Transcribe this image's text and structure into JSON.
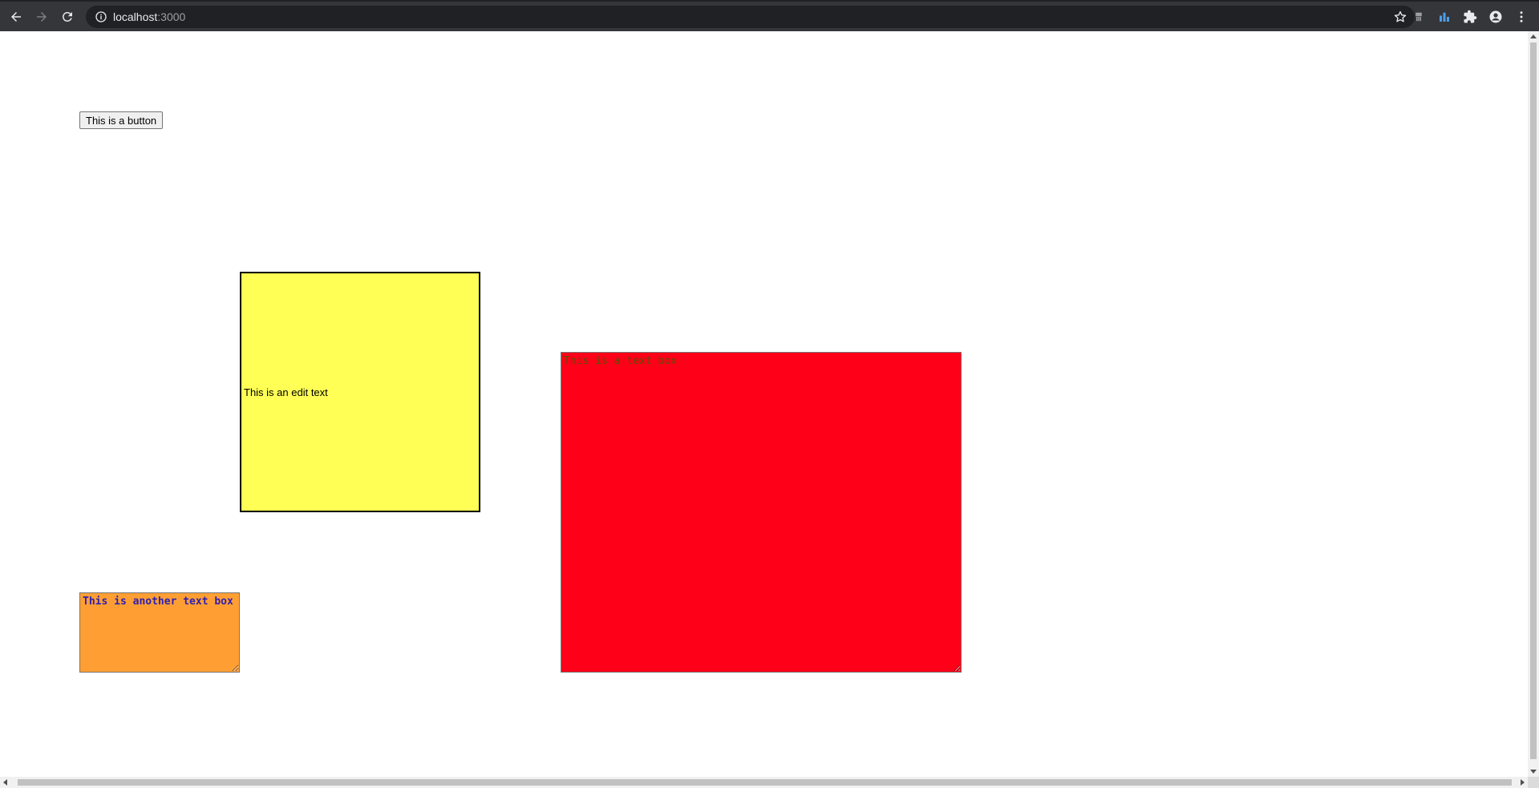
{
  "browser": {
    "url_host": "localhost",
    "url_port": ":3000",
    "icons": {
      "back": "arrow-left-icon",
      "forward": "arrow-right-icon",
      "reload": "reload-icon",
      "info": "info-icon",
      "bookmark": "star-icon",
      "extension_1": "extension-icon",
      "extension_2": "bar-chart-icon",
      "extensions_menu": "puzzle-icon",
      "profile": "profile-icon",
      "menu": "more-vertical-icon"
    }
  },
  "page": {
    "button_label": "This is a button",
    "edit_text": "This is an edit text",
    "text_box_value": "This is a text box",
    "another_text_box_value": "This is another text box"
  },
  "colors": {
    "toolbar": "#35363a",
    "omnibox": "#202124",
    "edit_text_bg": "#ffff55",
    "text_box_bg": "#ff0019",
    "another_text_box_bg": "#ff9f33"
  }
}
